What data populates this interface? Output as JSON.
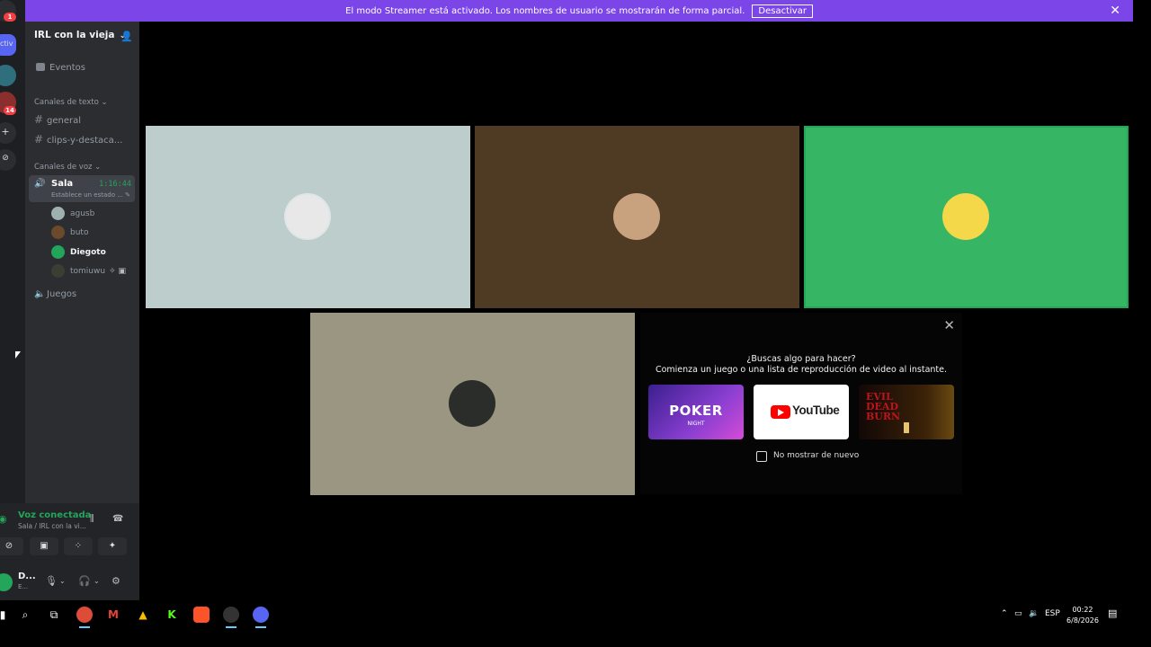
{
  "colors": {
    "banner": "#7b45e8",
    "voice_green": "#23a55a",
    "tile1": "#bccdcc",
    "tile2": "#4f3a24",
    "tile3": "#36b565",
    "tile4": "#9a9681"
  },
  "banner": {
    "message": "El modo Streamer está activado. Los nombres de usuario se mostrarán de forma parcial.",
    "button": "Desactivar",
    "close_icon": "close-icon"
  },
  "rail": {
    "badges": [
      "1",
      "14"
    ],
    "label": "ctiv"
  },
  "server": {
    "name": "IRL con la vieja",
    "events_label": "Eventos",
    "text_category": "Canales de texto",
    "text_channels": [
      "general",
      "clips-y-destaca..."
    ],
    "voice_category": "Canales de voz",
    "active_voice": {
      "name": "Sala",
      "time": "1:16:44",
      "status": "Establece un estado ..."
    },
    "voice_users": [
      "agusb",
      "buto",
      "Diegoto",
      "tomiuwu"
    ],
    "other_voice": "Juegos"
  },
  "voice_panel": {
    "title": "Voz conectada",
    "subtitle": "Sala / IRL con la vi...",
    "user_name": "D...",
    "user_status": "E..."
  },
  "activity": {
    "title": "¿Buscas algo para hacer?",
    "subtitle": "Comienza un juego o una lista de reproducción de video al instante.",
    "cards": [
      "POKER",
      "YouTube",
      "EVIL DEAD BURN"
    ],
    "poker_sub": "NIGHT",
    "checkbox_label": "No mostrar de nuevo"
  },
  "taskbar": {
    "lang": "ESP",
    "time": "00:22",
    "date": "6/8/2026"
  }
}
